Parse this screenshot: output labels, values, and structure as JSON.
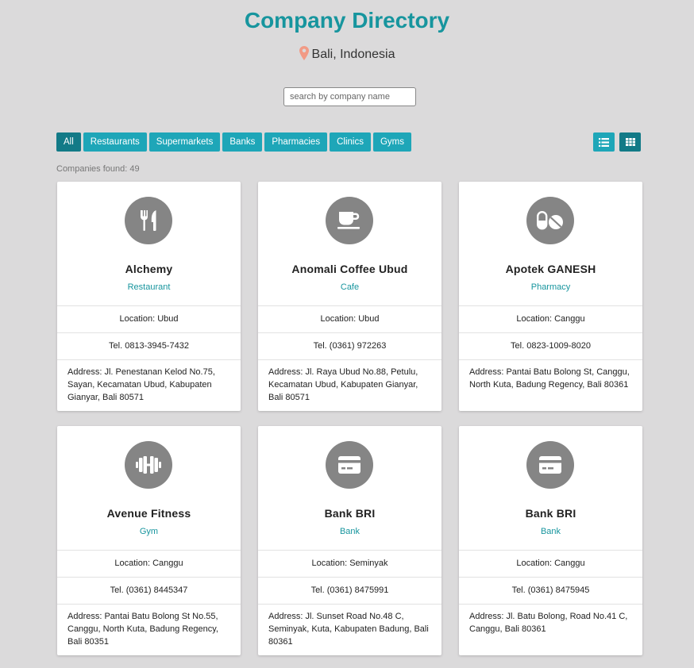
{
  "header": {
    "title": "Company Directory",
    "location": "Bali, Indonesia"
  },
  "search": {
    "placeholder": "search by company name",
    "value": ""
  },
  "filters": [
    {
      "label": "All",
      "active": true
    },
    {
      "label": "Restaurants",
      "active": false
    },
    {
      "label": "Supermarkets",
      "active": false
    },
    {
      "label": "Banks",
      "active": false
    },
    {
      "label": "Pharmacies",
      "active": false
    },
    {
      "label": "Clinics",
      "active": false
    },
    {
      "label": "Gyms",
      "active": false
    }
  ],
  "view": {
    "list_icon": "list-icon",
    "grid_icon": "grid-icon",
    "active": "grid"
  },
  "results": {
    "count_text": "Companies found: 49"
  },
  "colors": {
    "accent": "#17959e",
    "button": "#1ea6b8",
    "button_active": "#127a87",
    "icon_circle": "#858585",
    "pin": "#f29a85"
  },
  "companies": [
    {
      "name": "Alchemy",
      "category": "Restaurant",
      "icon": "utensils-icon",
      "location": "Location: Ubud",
      "phone": "Tel. 0813-3945-7432",
      "address": "Address: Jl. Penestanan Kelod No.75, Sayan, Kecamatan Ubud, Kabupaten Gianyar, Bali 80571"
    },
    {
      "name": "Anomali Coffee Ubud",
      "category": "Cafe",
      "icon": "coffee-icon",
      "location": "Location: Ubud",
      "phone": "Tel. (0361) 972263",
      "address": "Address: Jl. Raya Ubud No.88, Petulu, Kecamatan Ubud, Kabupaten Gianyar, Bali 80571"
    },
    {
      "name": "Apotek GANESH",
      "category": "Pharmacy",
      "icon": "pills-icon",
      "location": "Location: Canggu",
      "phone": "Tel. 0823-1009-8020",
      "address": "Address: Pantai Batu Bolong St, Canggu, North Kuta, Badung Regency, Bali 80361"
    },
    {
      "name": "Avenue Fitness",
      "category": "Gym",
      "icon": "dumbbell-icon",
      "location": "Location: Canggu",
      "phone": "Tel. (0361) 8445347",
      "address": "Address: Pantai Batu Bolong St No.55, Canggu, North Kuta, Badung Regency, Bali 80351"
    },
    {
      "name": "Bank BRI",
      "category": "Bank",
      "icon": "credit-card-icon",
      "location": "Location: Seminyak",
      "phone": "Tel. (0361) 8475991",
      "address": "Address: Jl. Sunset Road No.48 C, Seminyak, Kuta, Kabupaten Badung, Bali 80361"
    },
    {
      "name": "Bank BRI",
      "category": "Bank",
      "icon": "credit-card-icon",
      "location": "Location: Canggu",
      "phone": "Tel. (0361) 8475945",
      "address": "Address: Jl. Batu Bolong, Road No.41 C, Canggu, Bali 80361"
    }
  ]
}
